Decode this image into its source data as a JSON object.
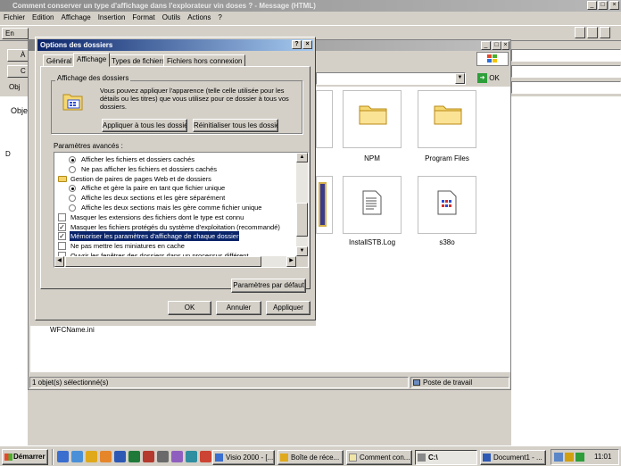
{
  "window": {
    "title": "Comment conserver un type d'affichage dans l'explorateur vin doses ? - Message (HTML)"
  },
  "menu": [
    "Fichier",
    "Edition",
    "Affichage",
    "Insertion",
    "Format",
    "Outils",
    "Actions",
    "?"
  ],
  "toolbar": {
    "send_label": "En"
  },
  "left_stubs": [
    "À",
    "C",
    "Obj",
    "Obje",
    "D"
  ],
  "explorer": {
    "go_label": "OK",
    "items": [
      {
        "name": "NPM",
        "icon": "folder-icon"
      },
      {
        "name": "Program Files",
        "icon": "folder-icon"
      },
      {
        "name": "InstallSTB.Log",
        "icon": "text-file-icon"
      },
      {
        "name": "s38o",
        "icon": "system-file-icon"
      }
    ],
    "behind_item": "WFCName.ini",
    "status_left": "1 objet(s) sélectionné(s)",
    "status_right": "Poste de travail"
  },
  "dialog": {
    "title": "Options des dossiers",
    "help_label": "?",
    "close_label": "×",
    "tabs": [
      "Général",
      "Affichage",
      "Types de fichiers",
      "Fichiers hors connexion"
    ],
    "active_tab": 1,
    "group_title": "Affichage des dossiers",
    "group_text": "Vous pouvez appliquer l'apparence (telle celle utilisée pour les détails ou les titres) que vous utilisez pour ce dossier à tous vos dossiers.",
    "apply_all_label": "Appliquer à tous les dossiers",
    "reset_all_label": "Réinitialiser tous les dossiers",
    "advanced_label": "Paramètres avancés :",
    "settings": [
      {
        "type": "radio",
        "checked": true,
        "indent": 1,
        "label": "Afficher les fichiers et dossiers cachés"
      },
      {
        "type": "radio",
        "checked": false,
        "indent": 1,
        "label": "Ne pas afficher les fichiers et dossiers cachés"
      },
      {
        "type": "folder",
        "checked": false,
        "indent": 0,
        "label": "Gestion de paires de pages Web et de dossiers"
      },
      {
        "type": "radio",
        "checked": true,
        "indent": 1,
        "label": "Affiche et gère la paire en tant que fichier unique"
      },
      {
        "type": "radio",
        "checked": false,
        "indent": 1,
        "label": "Affiche les deux sections et les gère séparément"
      },
      {
        "type": "radio",
        "checked": false,
        "indent": 1,
        "label": "Affiche les deux sections mais les gère comme fichier unique"
      },
      {
        "type": "check",
        "checked": false,
        "indent": 0,
        "label": "Masquer les extensions des fichiers dont le type est connu"
      },
      {
        "type": "check",
        "checked": true,
        "indent": 0,
        "label": "Masquer les fichiers protégés du système d'exploitation (recommandé)"
      },
      {
        "type": "check",
        "checked": true,
        "indent": 0,
        "label": "Mémoriser les paramètres d'affichage de chaque dossier",
        "selected": true
      },
      {
        "type": "check",
        "checked": false,
        "indent": 0,
        "label": "Ne pas mettre les miniatures en cache"
      },
      {
        "type": "check",
        "checked": false,
        "indent": 0,
        "label": "Ouvrir les fenêtres des dossiers dans un processus différent"
      }
    ],
    "defaults_label": "Paramètres par défaut",
    "ok_label": "OK",
    "cancel_label": "Annuler",
    "apply_label": "Appliquer"
  },
  "taskbar": {
    "start_label": "Démarrer",
    "tasks": [
      "Visio 2000 - [...",
      "Boîte de réce...",
      "Comment con...",
      "C:\\",
      "Document1 - ..."
    ],
    "clock": "11:01"
  },
  "colors": {
    "title_active": "#0a246a",
    "selection": "#0a246a",
    "face": "#d4d0c8"
  }
}
